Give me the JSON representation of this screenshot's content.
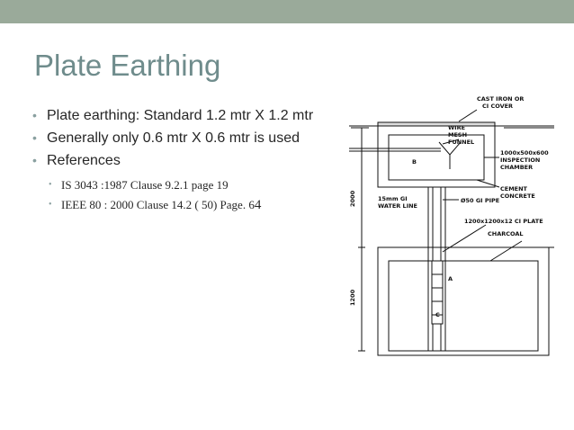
{
  "slide": {
    "title": "Plate Earthing",
    "bullets": [
      "Plate earthing: Standard 1.2 mtr X 1.2 mtr",
      "Generally only 0.6 mtr X 0.6 mtr is used",
      "References"
    ],
    "sub_bullets": [
      "IS 3043 :1987  Clause 9.2.1 page 19",
      "IEEE 80 : 2000 Clause  14.2 ( 50) Page. 6"
    ],
    "sub_bullet_tail": "4",
    "bullet_glyph": "•"
  },
  "diagram": {
    "labels": {
      "cover": "CAST IRON OR",
      "cover2": "CI COVER",
      "wire": "WIRE",
      "mesh": "MESH",
      "funnel": "FUNNEL",
      "dims": "1000x500x600",
      "chamber1": "INSPECTION",
      "chamber2": "CHAMBER",
      "b": "B",
      "cement1": "CEMENT",
      "cement2": "CONCRETE",
      "gi1": "15mm GI",
      "gi2": "WATER LINE",
      "pipe": "Ø50 GI PIPE",
      "plate": "1200x1200x12 CI PLATE",
      "charcoal": "CHARCOAL",
      "a": "A",
      "c": "C",
      "dim_upper": "2000",
      "dim_lower": "1200"
    }
  },
  "colors": {
    "band": "#9aaa9a",
    "title": "#6f8c8c",
    "text": "#262626",
    "bullet": "#8aa0a0"
  }
}
